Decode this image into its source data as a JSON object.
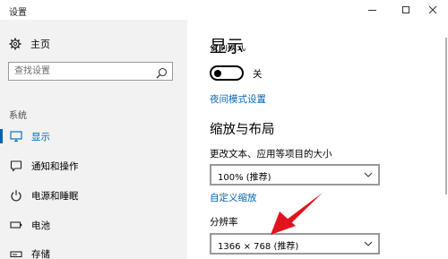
{
  "window": {
    "title": "设置"
  },
  "sidebar": {
    "home_label": "主页",
    "search_placeholder": "查找设置",
    "section_label": "系统",
    "items": [
      {
        "label": "显示",
        "icon": "monitor-icon",
        "active": true
      },
      {
        "label": "通知和操作",
        "icon": "notification-icon",
        "active": false
      },
      {
        "label": "电源和睡眠",
        "icon": "power-icon",
        "active": false
      },
      {
        "label": "电池",
        "icon": "battery-icon",
        "active": false
      },
      {
        "label": "存储",
        "icon": "storage-icon",
        "active": false
      }
    ]
  },
  "main": {
    "page_title": "显示",
    "night_light_label_partial": "夜间模式",
    "toggle_state": "关",
    "night_light_settings_link": "夜间模式设置",
    "scale_section_title": "缩放与布局",
    "scale_label": "更改文本、应用等项目的大小",
    "scale_value": "100% (推荐)",
    "custom_scaling_link": "自定义缩放",
    "resolution_label": "分辨率",
    "resolution_value": "1366 × 768 (推荐)"
  },
  "colors": {
    "accent": "#0063b1",
    "sidebar_bg": "#f2f2f2",
    "annotation_arrow": "#e0141e"
  }
}
